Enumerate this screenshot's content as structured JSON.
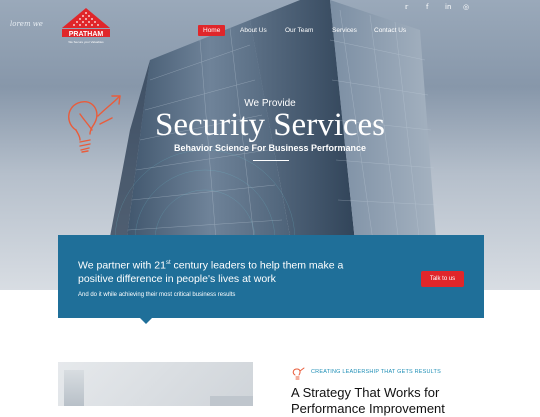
{
  "social": {
    "icons": [
      "twitter-icon",
      "facebook-icon",
      "linkedin-icon",
      "instagram-icon"
    ]
  },
  "brand": {
    "tagline_script": "lorem we",
    "logo_text": "PRATHAM",
    "logo_sub": "We Secure your Valuables"
  },
  "nav": {
    "items": [
      "Home",
      "About Us",
      "Our Team",
      "Services",
      "Contact Us"
    ],
    "active": "Home"
  },
  "hero": {
    "pretitle": "We Provide",
    "title": "Security Services",
    "subtitle": "Behavior Science For Business Performance"
  },
  "cta": {
    "headline_pre": "We partner with 21",
    "headline_sup": "st",
    "headline_post": " century leaders to help them make a positive difference in people's lives at work",
    "subtext": "And do it while achieving their most critical business results",
    "button": "Talk to us"
  },
  "section": {
    "kicker": "CREATING LEADERSHIP THAT GETS RESULTS",
    "title": "A Strategy That Works for Performance Improvement"
  },
  "colors": {
    "accent": "#e0262a",
    "card": "#1f6f99",
    "kicker": "#1f8fb6"
  }
}
